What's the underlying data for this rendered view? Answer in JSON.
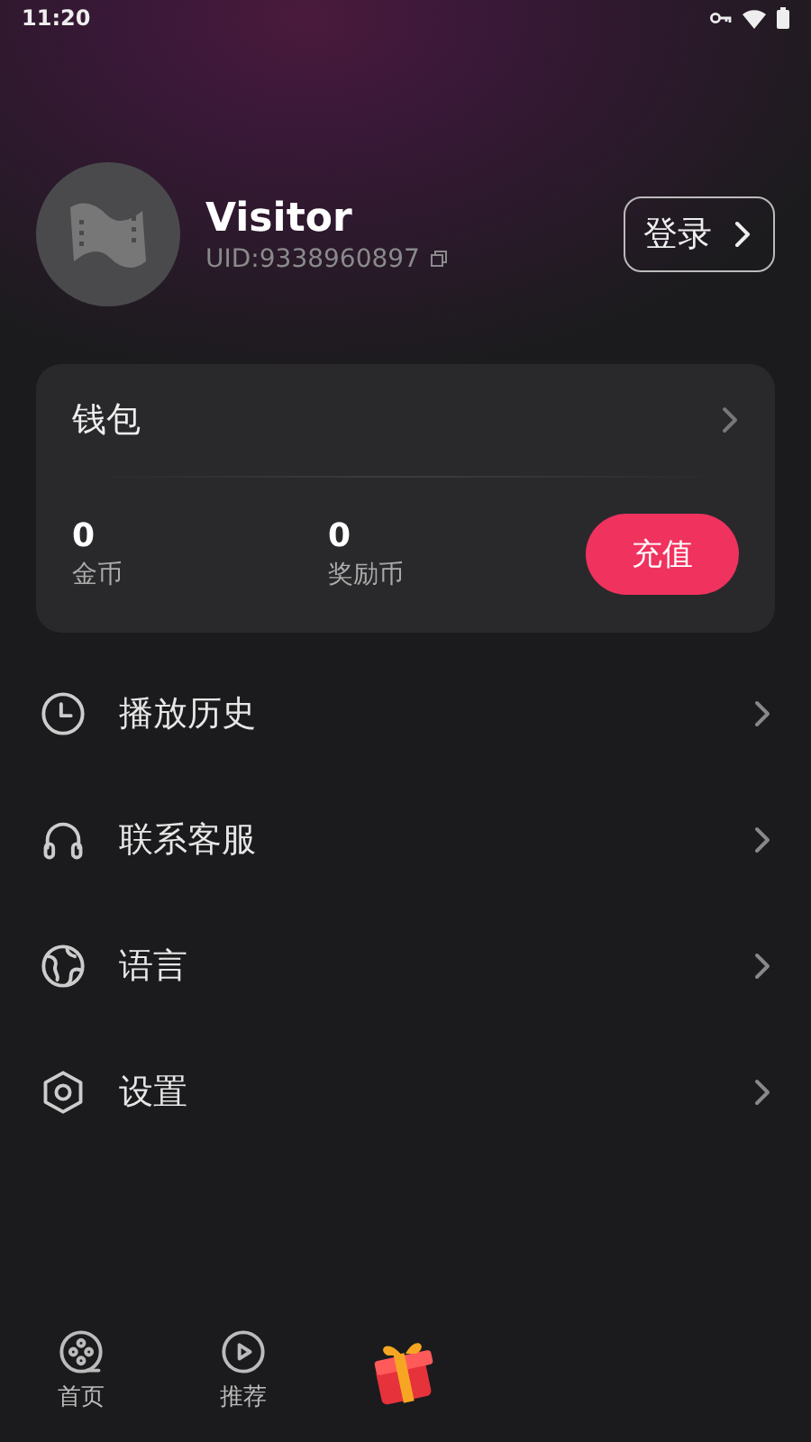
{
  "status_bar": {
    "time": "11:20"
  },
  "profile": {
    "name": "Visitor",
    "uid": "UID:9338960897",
    "login_button": "登录"
  },
  "wallet": {
    "title": "钱包",
    "balances": [
      {
        "value": "0",
        "label": "金币"
      },
      {
        "value": "0",
        "label": "奖励币"
      }
    ],
    "recharge_button": "充值"
  },
  "menu": [
    {
      "kind": "clock",
      "label": "播放历史"
    },
    {
      "kind": "headset",
      "label": "联系客服"
    },
    {
      "kind": "globe",
      "label": "语言"
    },
    {
      "kind": "hexagon",
      "label": "设置"
    }
  ],
  "bottom_nav": [
    {
      "kind": "reel",
      "label": "首页"
    },
    {
      "kind": "play",
      "label": "推荐"
    },
    {
      "kind": "gift"
    }
  ]
}
